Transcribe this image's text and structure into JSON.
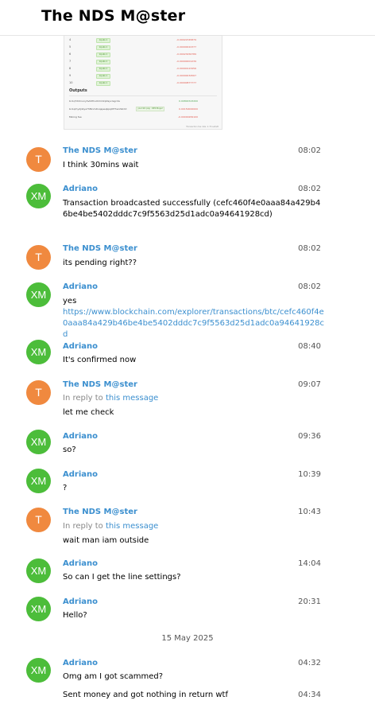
{
  "header": {
    "title": "The NDS M@ster"
  },
  "snippet": {
    "rows": [
      {
        "num": "4",
        "pill": "Inputs 1",
        "val": "-0.00022345879"
      },
      {
        "num": "5",
        "pill": "Inputs 1",
        "val": "-0.00000022377"
      },
      {
        "num": "6",
        "pill": "Inputs 1",
        "val": "-0.00023456789"
      },
      {
        "num": "7",
        "pill": "Inputs 1",
        "val": "-0.00000001239"
      },
      {
        "num": "8",
        "pill": "Inputs 1",
        "val": "-0.00000123456"
      },
      {
        "num": "9",
        "pill": "Inputs 1",
        "val": "-0.00000034567"
      },
      {
        "num": "10",
        "pill": "Inputs 1",
        "val": "-0.00000877777"
      }
    ],
    "outputs_title": "Outputs",
    "output_rows": [
      {
        "addr": "bc1q72drnunyhv0dfnu0rmmkp0syvrsgcda",
        "val": "0.00891543200"
      },
      {
        "addr": "bc1qrhydjdzys7hf4nmdlvqsjesqkpq0f7hanh0rdd",
        "tag": "your btc pay · DEX Buyer",
        "val": "0.00150000000"
      },
      {
        "addr": "Mining fee",
        "val": "-0.00000284100"
      }
    ],
    "footer": "Transaction fee rate: 2.79 sat/vB"
  },
  "messages": [
    {
      "avatar": "T",
      "sender": "The NDS M@ster",
      "time": "08:02",
      "text": "I think 30mins wait"
    },
    {
      "avatar": "XM",
      "sender": "Adriano",
      "time": "08:02",
      "text": "Transaction broadcasted successfully (cefc460f4e0aaa84a429b46be4be5402dddc7c9f5563d25d1adc0a94641928cd)"
    },
    {
      "avatar": "T",
      "sender": "The NDS M@ster",
      "time": "08:02",
      "text": "its pending right??"
    },
    {
      "avatar": "XM",
      "sender": "Adriano",
      "time": "08:02",
      "text": "yes",
      "link": "https://www.blockchain.com/explorer/transactions/btc/cefc460f4e0aaa84a429b46be4be5402dddc7c9f5563d25d1adc0a94641928cd"
    },
    {
      "avatar": "XM",
      "sender": "Adriano",
      "time": "08:40",
      "text": "It's confirmed now"
    },
    {
      "avatar": "T",
      "sender": "The NDS M@ster",
      "time": "09:07",
      "reply_prefix": "In reply to",
      "reply_link": "this message",
      "text": "let me check"
    },
    {
      "avatar": "XM",
      "sender": "Adriano",
      "time": "09:36",
      "text": "so?"
    },
    {
      "avatar": "XM",
      "sender": "Adriano",
      "time": "10:39",
      "text": "?"
    },
    {
      "avatar": "T",
      "sender": "The NDS M@ster",
      "time": "10:43",
      "reply_prefix": "In reply to",
      "reply_link": "this message",
      "text": "wait man iam outside"
    },
    {
      "avatar": "XM",
      "sender": "Adriano",
      "time": "14:04",
      "text": "So can I get the line settings?"
    },
    {
      "avatar": "XM",
      "sender": "Adriano",
      "time": "20:31",
      "text": "Hello?"
    },
    {
      "avatar": "XM",
      "sender": "Adriano",
      "time": "04:32",
      "text": "Omg am I got scammed?"
    },
    {
      "time": "04:34",
      "text": "Sent money and got nothing in return wtf"
    }
  ],
  "date_separator": "15 May 2025",
  "colors": {
    "accent": "#3b8fcf",
    "avatar_orange": "#f0893f",
    "avatar_green": "#4cbd3a"
  }
}
